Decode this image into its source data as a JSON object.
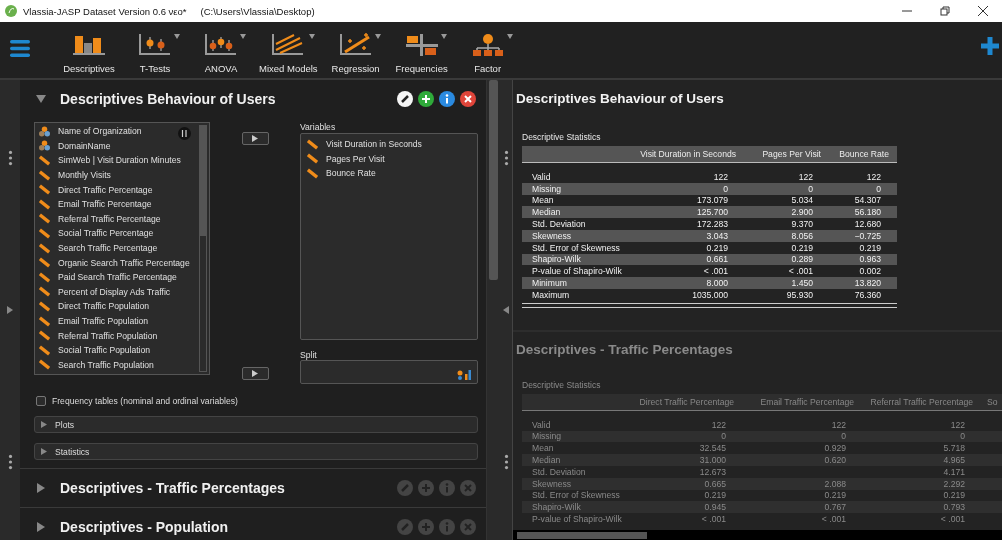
{
  "window": {
    "title": "Vlassia-JASP Dataset Version 0.6 νεο*",
    "path": "(C:\\Users\\Vlassia\\Desktop)"
  },
  "toolbar": {
    "items": [
      {
        "label": "Descriptives",
        "kind": "bars",
        "dropdown": false
      },
      {
        "label": "T-Tests",
        "kind": "ttest",
        "dropdown": true
      },
      {
        "label": "ANOVA",
        "kind": "anova",
        "dropdown": true
      },
      {
        "label": "Mixed Models",
        "kind": "mixed",
        "dropdown": true
      },
      {
        "label": "Regression",
        "kind": "regression",
        "dropdown": true
      },
      {
        "label": "Frequencies",
        "kind": "freq",
        "dropdown": true
      },
      {
        "label": "Factor",
        "kind": "factor",
        "dropdown": true
      }
    ]
  },
  "analyses": [
    {
      "title": "Descriptives Behaviour of Users",
      "expanded": true,
      "source_variables": [
        {
          "name": "Name of Organization",
          "kind": "nominal"
        },
        {
          "name": "DomainName",
          "kind": "nominal"
        },
        {
          "name": "SimWeb | Visit Duration Minutes",
          "kind": "scale"
        },
        {
          "name": "Monthly Visits",
          "kind": "scale"
        },
        {
          "name": "Direct Traffic Percentage",
          "kind": "scale"
        },
        {
          "name": "Email Traffic Percentage",
          "kind": "scale"
        },
        {
          "name": "Referral Traffic Percentage",
          "kind": "scale"
        },
        {
          "name": "Social Traffic Percentage",
          "kind": "scale"
        },
        {
          "name": "Search Traffic Percentage",
          "kind": "scale"
        },
        {
          "name": "Organic Search Traffic Percentage",
          "kind": "scale"
        },
        {
          "name": "Paid Search Traffic Percentage",
          "kind": "scale"
        },
        {
          "name": "Percent of Display Ads Traffic",
          "kind": "scale"
        },
        {
          "name": "Direct Traffic Population",
          "kind": "scale"
        },
        {
          "name": "Email Traffic Population",
          "kind": "scale"
        },
        {
          "name": "Referral Traffic Population",
          "kind": "scale"
        },
        {
          "name": "Social Traffic Population",
          "kind": "scale"
        },
        {
          "name": "Search Traffic Population",
          "kind": "scale"
        }
      ],
      "variables_label": "Variables",
      "variables": [
        {
          "name": "Visit Duration in Seconds",
          "kind": "scale"
        },
        {
          "name": "Pages Per Visit",
          "kind": "scale"
        },
        {
          "name": "Bounce Rate",
          "kind": "scale"
        }
      ],
      "split_label": "Split",
      "frequency_tables": {
        "label": "Frequency tables (nominal and ordinal variables)",
        "checked": false
      },
      "sections": [
        {
          "label": "Plots",
          "expanded": false
        },
        {
          "label": "Statistics",
          "expanded": false
        }
      ]
    },
    {
      "title": "Descriptives - Traffic Percentages",
      "expanded": false
    },
    {
      "title": "Descriptives - Population",
      "expanded": false
    }
  ],
  "results": [
    {
      "title": "Descriptives Behaviour of Users",
      "active": true,
      "table": {
        "title": "Descriptive Statistics",
        "columns": [
          "Visit Duration in Seconds",
          "Pages Per Visit",
          "Bounce Rate"
        ],
        "rows": [
          {
            "label": "Valid",
            "values": [
              "122",
              "122",
              "122"
            ]
          },
          {
            "label": "Missing",
            "values": [
              "0",
              "0",
              "0"
            ]
          },
          {
            "label": "Mean",
            "values": [
              "173.079",
              "5.034",
              "54.307"
            ]
          },
          {
            "label": "Median",
            "values": [
              "125.700",
              "2.900",
              "56.180"
            ]
          },
          {
            "label": "Std. Deviation",
            "values": [
              "172.283",
              "9.370",
              "12.680"
            ]
          },
          {
            "label": "Skewness",
            "values": [
              "3.043",
              "8.056",
              "−0.725"
            ]
          },
          {
            "label": "Std. Error of Skewness",
            "values": [
              "0.219",
              "0.219",
              "0.219"
            ]
          },
          {
            "label": "Shapiro-Wilk",
            "values": [
              "0.661",
              "0.289",
              "0.963"
            ]
          },
          {
            "label": "P-value of Shapiro-Wilk",
            "values": [
              "< .001",
              "< .001",
              "0.002"
            ]
          },
          {
            "label": "Minimum",
            "values": [
              "8.000",
              "1.450",
              "13.820"
            ]
          },
          {
            "label": "Maximum",
            "values": [
              "1035.000",
              "95.930",
              "76.360"
            ]
          }
        ]
      }
    },
    {
      "title": "Descriptives - Traffic Percentages",
      "active": false,
      "table": {
        "title": "Descriptive Statistics",
        "columns": [
          "Direct Traffic Percentage",
          "Email Traffic Percentage",
          "Referral Traffic Percentage",
          "So"
        ],
        "rows": [
          {
            "label": "Valid",
            "values": [
              "122",
              "122",
              "122"
            ]
          },
          {
            "label": "Missing",
            "values": [
              "0",
              "0",
              "0"
            ]
          },
          {
            "label": "Mean",
            "values": [
              "32.545",
              "0.929",
              "5.718"
            ]
          },
          {
            "label": "Median",
            "values": [
              "31.000",
              "0.620",
              "4.965"
            ]
          },
          {
            "label": "Std. Deviation",
            "values": [
              "12.673",
              {
                "covered": true
              },
              "4.171"
            ]
          },
          {
            "label": "Skewness",
            "values": [
              "0.665",
              "2.088",
              "2.292"
            ]
          },
          {
            "label": "Std. Error of Skewness",
            "values": [
              "0.219",
              "0.219",
              "0.219"
            ]
          },
          {
            "label": "Shapiro-Wilk",
            "values": [
              "0.945",
              "0.767",
              "0.793"
            ]
          },
          {
            "label": "P-value of Shapiro-Wilk",
            "values": [
              "< .001",
              "< .001",
              "< .001"
            ]
          }
        ]
      }
    }
  ]
}
